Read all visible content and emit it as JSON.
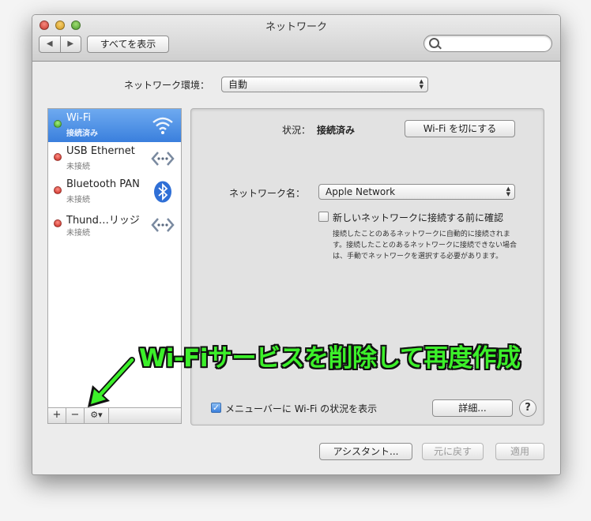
{
  "window": {
    "title": "ネットワーク"
  },
  "toolbar": {
    "back_glyph": "◀",
    "forward_glyph": "▶",
    "show_all_label": "すべてを表示",
    "search_placeholder": ""
  },
  "location": {
    "label": "ネットワーク環境：",
    "value": "自動"
  },
  "services": [
    {
      "name": "Wi-Fi",
      "status": "接続済み",
      "state": "connected",
      "icon": "wifi-icon",
      "selected": true
    },
    {
      "name": "USB Ethernet",
      "status": "未接続",
      "state": "disconnected",
      "icon": "ethernet-icon",
      "selected": false
    },
    {
      "name": "Bluetooth PAN",
      "status": "未接続",
      "state": "disconnected",
      "icon": "bluetooth-icon",
      "selected": false
    },
    {
      "name": "Thund…リッジ",
      "status": "未接続",
      "state": "disconnected",
      "icon": "ethernet-icon",
      "selected": false
    }
  ],
  "sidebar_controls": {
    "add": "+",
    "remove": "−",
    "gear": "⚙▾"
  },
  "detail": {
    "status_label": "状況：",
    "status_value": "接続済み",
    "wifi_toggle_label": "Wi-Fi を切にする",
    "network_name_label": "ネットワーク名：",
    "network_name_value": "Apple Network",
    "ask_join_label": "新しいネットワークに接続する前に確認",
    "ask_join_checked": false,
    "ask_join_description": "接続したことのあるネットワークに自動的に接続されます。接続したことのあるネットワークに接続できない場合は、手動でネットワークを選択する必要があります。",
    "show_menubar_label": "メニューバーに Wi-Fi の状況を表示",
    "show_menubar_checked": true,
    "advanced_label": "詳細...",
    "help_label": "?"
  },
  "footer": {
    "assistant_label": "アシスタント...",
    "revert_label": "元に戻す",
    "apply_label": "適用"
  },
  "annotation": {
    "text": "Wi-Fiサービスを削除して再度作成",
    "color": "#3cf02a"
  },
  "colors": {
    "selection": "#3a7fdd",
    "connected": "#3d9e21",
    "disconnected": "#c2231a"
  }
}
